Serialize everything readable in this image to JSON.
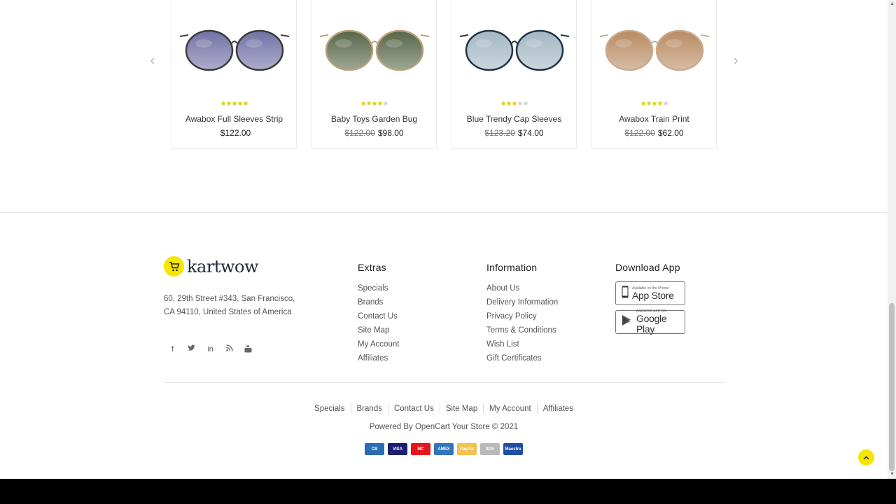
{
  "carousel": {
    "prev_icon": "chevron-left-icon",
    "next_icon": "chevron-right-icon",
    "products": [
      {
        "name": "Awabox Full Sleeves Strip",
        "price": "$122.00",
        "old_price": "",
        "rating": 5,
        "lens_color": "#6b6aa0",
        "frame_color": "#3a3a3a"
      },
      {
        "name": "Baby Toys Garden Bug",
        "price": "$98.00",
        "old_price": "$122.00",
        "rating": 4,
        "lens_color": "#4e5e3e",
        "frame_color": "#b8a27a"
      },
      {
        "name": "Blue Trendy Cap Sleeves",
        "price": "$74.00",
        "old_price": "$123.20",
        "rating": 3,
        "lens_color": "#9fb4bf",
        "frame_color": "#1e3346"
      },
      {
        "name": "Awabox Train Print",
        "price": "$62.00",
        "old_price": "$122.00",
        "rating": 4,
        "lens_color": "#b5855a",
        "frame_color": "#c9a98f"
      }
    ]
  },
  "footer": {
    "logo_text": "kartwow",
    "address": "60, 29th Street #343, San Francisco, CA 94110, United States of America",
    "socials": [
      "f",
      "t",
      "in",
      "rss",
      "yt"
    ],
    "extras": {
      "title": "Extras",
      "links": [
        "Specials",
        "Brands",
        "Contact Us",
        "Site Map",
        "My Account",
        "Affiliates"
      ]
    },
    "information": {
      "title": "Information",
      "links": [
        "About Us",
        "Delivery Information",
        "Privacy Policy",
        "Terms & Conditions",
        "Wish List",
        "Gift Certificates"
      ]
    },
    "download": {
      "title": "Download App",
      "app_store_small": "Available on the iPhone",
      "app_store_big": "App Store",
      "google_small": "ANDROID APP ON",
      "google_big": "Google Play"
    },
    "bottom_links": [
      "Specials",
      "Brands",
      "Contact Us",
      "Site Map",
      "My Account",
      "Affiliates"
    ],
    "powered": "Powered By OpenCart Your Store © 2021",
    "payments": [
      {
        "label": "CB",
        "color": "#2a6db5"
      },
      {
        "label": "VISA",
        "color": "#1a1f71"
      },
      {
        "label": "MC",
        "color": "#e4161b"
      },
      {
        "label": "AMEX",
        "color": "#2e77bb"
      },
      {
        "label": "PayPal",
        "color": "#f2c14e"
      },
      {
        "label": "3DS",
        "color": "#b9b9b9"
      },
      {
        "label": "Maestro",
        "color": "#1e4fa3"
      }
    ]
  },
  "back_to_top_icon": "chevron-up-icon"
}
